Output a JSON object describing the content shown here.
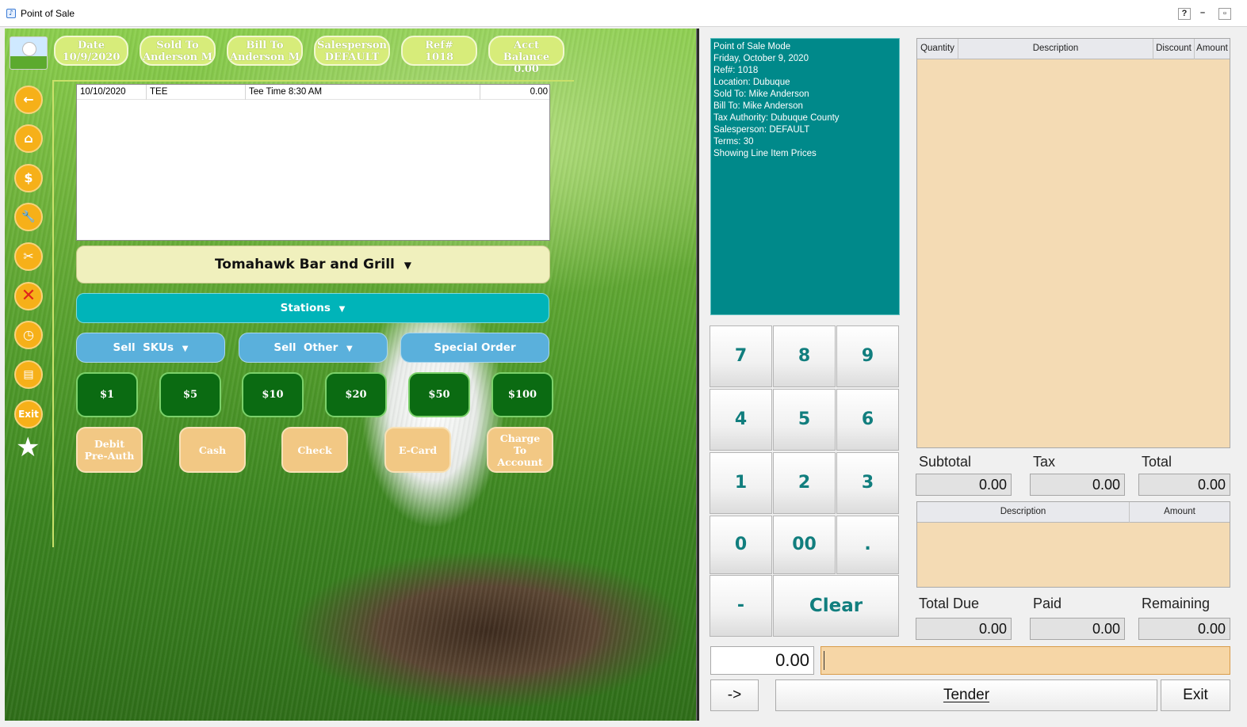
{
  "window": {
    "title": "Point of Sale",
    "help_label": "?",
    "minimize_label": "–",
    "restore_label": "▫"
  },
  "header": [
    {
      "label": "Date",
      "value": "10/9/2020"
    },
    {
      "label": "Sold To",
      "value": "Anderson M"
    },
    {
      "label": "Bill To",
      "value": "Anderson M"
    },
    {
      "label": "Salesperson",
      "value": "DEFAULT"
    },
    {
      "label": "Ref#",
      "value": "1018"
    },
    {
      "label": "Acct Balance",
      "value": "0.00"
    }
  ],
  "sidebar": {
    "items": [
      {
        "icon": "back-arrow-icon",
        "glyph": "←"
      },
      {
        "icon": "home-icon",
        "glyph": "⌂"
      },
      {
        "icon": "money-bag-icon",
        "glyph": "$"
      },
      {
        "icon": "wrench-icon",
        "glyph": "🔧"
      },
      {
        "icon": "scissors-icon",
        "glyph": "✂"
      },
      {
        "icon": "cancel-x-icon",
        "glyph": "✕"
      },
      {
        "icon": "clock-icon",
        "glyph": "◷"
      },
      {
        "icon": "register-icon",
        "glyph": "▤"
      }
    ],
    "exit_label": "Exit",
    "star_glyph": "★"
  },
  "line_items": [
    {
      "date": "10/10/2020",
      "code": "TEE",
      "description": "Tee Time 8:30 AM",
      "amount": "0.00"
    }
  ],
  "location_selector": {
    "label": "Tomahawk Bar and Grill",
    "caret": "▼"
  },
  "stations": {
    "label": "Stations",
    "caret": "▼"
  },
  "actions": [
    {
      "label": "Sell  SKUs",
      "caret": "▼"
    },
    {
      "label": "Sell  Other",
      "caret": "▼"
    },
    {
      "label": "Special Order",
      "caret": ""
    }
  ],
  "quick_cash": [
    "$1",
    "$5",
    "$10",
    "$20",
    "$50",
    "$100"
  ],
  "tenders": [
    {
      "line1": "Debit",
      "line2": "Pre-Auth",
      "line3": ""
    },
    {
      "line1": "Cash",
      "line2": "",
      "line3": ""
    },
    {
      "line1": "Check",
      "line2": "",
      "line3": ""
    },
    {
      "line1": "E-Card",
      "line2": "",
      "line3": ""
    },
    {
      "line1": "Charge",
      "line2": "To",
      "line3": "Account"
    }
  ],
  "info_panel": [
    "Point of Sale Mode",
    "Friday, October 9, 2020",
    "Ref#: 1018",
    "Location: Dubuque",
    "Sold To: Mike Anderson",
    "Bill To: Mike Anderson",
    "Tax Authority: Dubuque County",
    "Salesperson: DEFAULT",
    "Terms: 30",
    "Showing Line Item Prices"
  ],
  "keypad": [
    "7",
    "8",
    "9",
    "4",
    "5",
    "6",
    "1",
    "2",
    "3",
    "0",
    "00",
    ".",
    "-",
    "Clear"
  ],
  "items_grid": {
    "columns": [
      "Quantity",
      "Description",
      "Discount",
      "Amount"
    ]
  },
  "totals": {
    "subtotal_label": "Subtotal",
    "subtotal": "0.00",
    "tax_label": "Tax",
    "tax": "0.00",
    "total_label": "Total",
    "total": "0.00"
  },
  "payments_grid": {
    "columns": [
      "Description",
      "Amount"
    ]
  },
  "due": {
    "total_due_label": "Total Due",
    "total_due": "0.00",
    "paid_label": "Paid",
    "paid": "0.00",
    "remaining_label": "Remaining",
    "remaining": "0.00"
  },
  "entry": {
    "amount": "0.00",
    "text": ""
  },
  "footer": {
    "arrow_label": "->",
    "tender_label": "Tender",
    "exit_label": "Exit"
  },
  "colors": {
    "accent_teal": "#00898a",
    "stations": "#00b4b9",
    "sidebar_orange": "#f6b019",
    "cash_green": "#0b6b12",
    "header_lime": "#d7ec7a"
  }
}
